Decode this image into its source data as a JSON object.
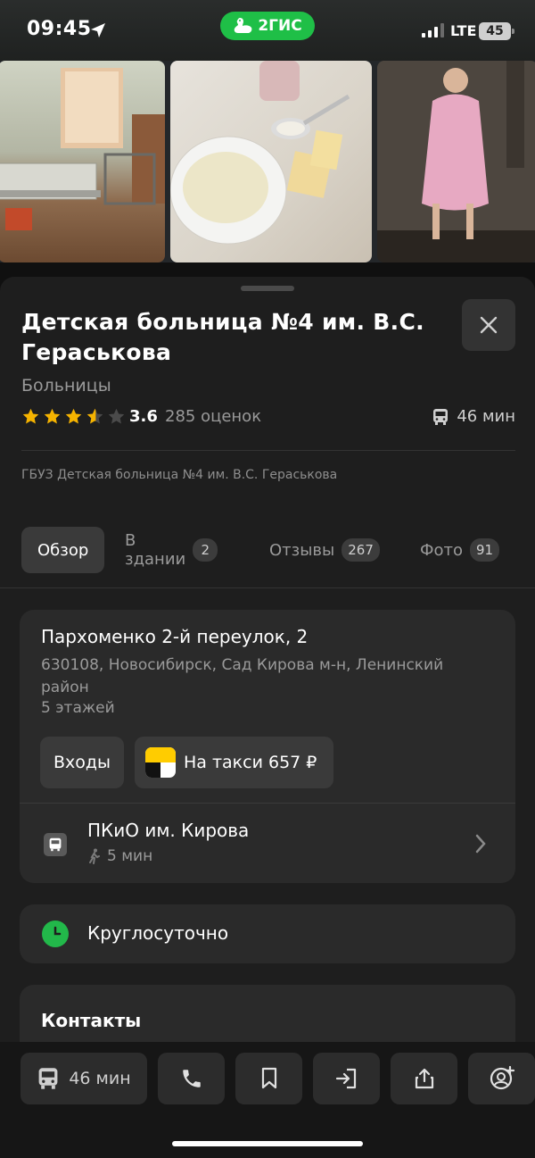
{
  "status_bar": {
    "time": "09:45",
    "brand": "2ГИС",
    "network": "LTE",
    "battery": "45"
  },
  "place": {
    "title": "Детская больница №4 им. В.С. Гераськова",
    "category": "Больницы",
    "rating": "3.6",
    "rating_value": 3.6,
    "ratings_count": "285 оценок",
    "travel_time": "46 мин",
    "legal_name": "ГБУЗ Детская больница №4 им. В.С. Гераськова"
  },
  "tabs": [
    {
      "label": "Обзор",
      "badge": ""
    },
    {
      "label": "В здании",
      "badge": "2"
    },
    {
      "label": "Отзывы",
      "badge": "267"
    },
    {
      "label": "Фото",
      "badge": "91"
    }
  ],
  "address": {
    "street": "Пархоменко 2-й переулок, 2",
    "details": "630108, Новосибирск, Сад Кирова м-н, Ленинский район",
    "floors": "5 этажей",
    "entrances_button": "Входы",
    "taxi_button": "На такси 657 ₽"
  },
  "transit": {
    "stop_name": "ПКиО им. Кирова",
    "walk_time": "5 мин"
  },
  "hours": {
    "text": "Круглосуточно"
  },
  "contacts": {
    "title": "Контакты"
  },
  "bottom_bar": {
    "route_time": "46 мин"
  },
  "colors": {
    "accent_green": "#22b84a",
    "star_yellow": "#f5b300",
    "sheet_bg": "#1e1e1e",
    "card_bg": "#2a2a2a"
  },
  "icons": [
    "location-arrow-icon",
    "brand-goose-icon",
    "signal-icon",
    "battery-icon",
    "close-icon",
    "star-icon",
    "bus-icon",
    "taxi-logo-icon",
    "walk-icon",
    "chevron-right-icon",
    "clock-icon",
    "phone-icon",
    "bookmark-icon",
    "enter-icon",
    "share-icon",
    "add-friend-icon"
  ]
}
